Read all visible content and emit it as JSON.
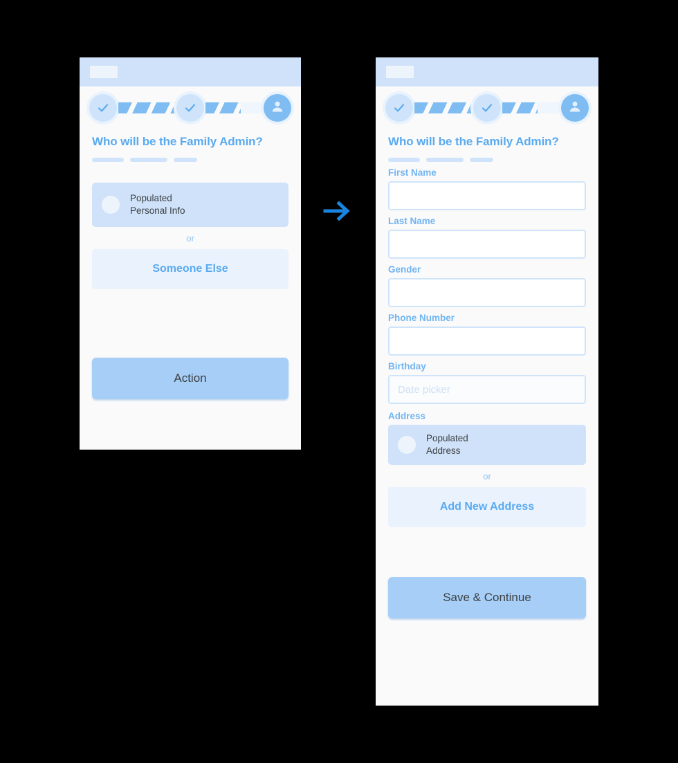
{
  "colors": {
    "accent": "#1a85e0",
    "title_blue": "#59aaf0",
    "label_blue": "#72b5f2",
    "header_bar": "#cfe2f9",
    "card_fill": "#cfe2f9",
    "primary_button": "#a6cef7",
    "secondary_button": "#eaf2fd",
    "panel_bg": "#fafafa",
    "canvas_bg": "#000000"
  },
  "flow": {
    "arrow_icon": "arrow-right-icon",
    "arrow_direction": "right"
  },
  "before_screen": {
    "header": {
      "logo_placeholder": ""
    },
    "stepper": {
      "steps": [
        {
          "icon": "check-icon",
          "state": "completed"
        },
        {
          "icon": "check-icon",
          "state": "completed"
        },
        {
          "icon": "person-icon",
          "state": "active"
        }
      ],
      "connectors": [
        {
          "fill_percent": 100
        },
        {
          "fill_percent": 62
        }
      ]
    },
    "title": "Who will be the Family Admin?",
    "placeholder_bars": [
      46,
      54,
      34
    ],
    "option_card": {
      "label": "Populated\nPersonal Info",
      "radio_selected": false
    },
    "or_label": "or",
    "secondary_button": "Someone Else",
    "primary_button": "Action"
  },
  "after_screen": {
    "header": {
      "logo_placeholder": ""
    },
    "stepper": {
      "steps": [
        {
          "icon": "check-icon",
          "state": "completed"
        },
        {
          "icon": "check-icon",
          "state": "completed"
        },
        {
          "icon": "person-icon",
          "state": "active"
        }
      ],
      "connectors": [
        {
          "fill_percent": 100
        },
        {
          "fill_percent": 62
        }
      ]
    },
    "title": "Who will be the Family Admin?",
    "placeholder_bars": [
      46,
      54,
      34
    ],
    "fields": [
      {
        "label": "First Name",
        "value": "",
        "placeholder": ""
      },
      {
        "label": "Last Name",
        "value": "",
        "placeholder": ""
      },
      {
        "label": "Gender",
        "value": "",
        "placeholder": ""
      },
      {
        "label": "Phone Number",
        "value": "",
        "placeholder": ""
      },
      {
        "label": "Birthday",
        "value": "",
        "placeholder": "Date picker"
      }
    ],
    "address_section": {
      "label": "Address",
      "option_card": {
        "label": "Populated\nAddress",
        "radio_selected": false
      },
      "or_label": "or",
      "secondary_button": "Add New Address"
    },
    "primary_button": "Save & Continue"
  }
}
